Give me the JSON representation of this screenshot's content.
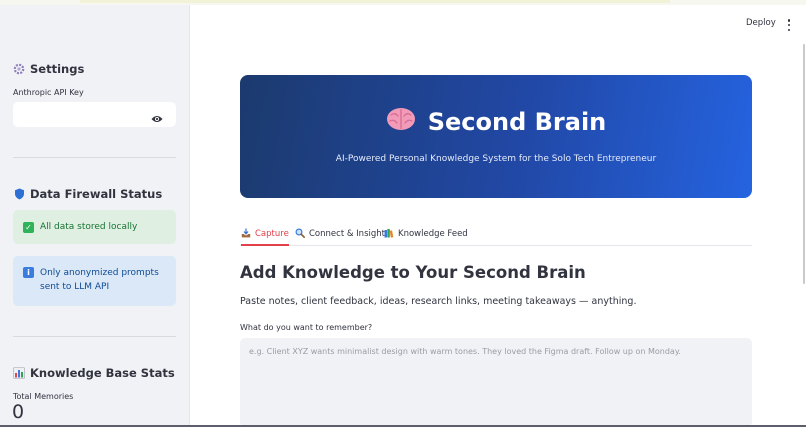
{
  "header": {
    "deploy_label": "Deploy",
    "menu_icon": "kebab-menu-icon"
  },
  "sidebar": {
    "settings_heading": "Settings",
    "api_key_label": "Anthropic API Key",
    "api_key_value": "",
    "firewall_heading": "Data Firewall Status",
    "alert_success": "All data stored locally",
    "alert_info": "Only anonymized prompts sent to LLM API",
    "stats_heading": "Knowledge Base Stats",
    "total_memories_label": "Total Memories",
    "total_memories_value": "0"
  },
  "hero": {
    "title": "Second Brain",
    "subtitle": "AI-Powered Personal Knowledge System for the Solo Tech Entrepreneur"
  },
  "tabs": [
    {
      "label": "Capture",
      "active": true
    },
    {
      "label": "Connect & Insight",
      "active": false
    },
    {
      "label": "Knowledge Feed",
      "active": false
    }
  ],
  "main": {
    "heading": "Add Knowledge to Your Second Brain",
    "lead": "Paste notes, client feedback, ideas, research links, meeting takeaways — anything.",
    "input_label": "What do you want to remember?",
    "input_placeholder": "e.g. Client XYZ wants minimalist design with warm tones. They loved the Figma draft. Follow up on Monday."
  },
  "colors": {
    "accent": "#e0414a",
    "success_bg": "#dff0e2",
    "info_bg": "#dbe8f7",
    "hero_start": "#1c3a6e",
    "hero_end": "#2563e0"
  }
}
